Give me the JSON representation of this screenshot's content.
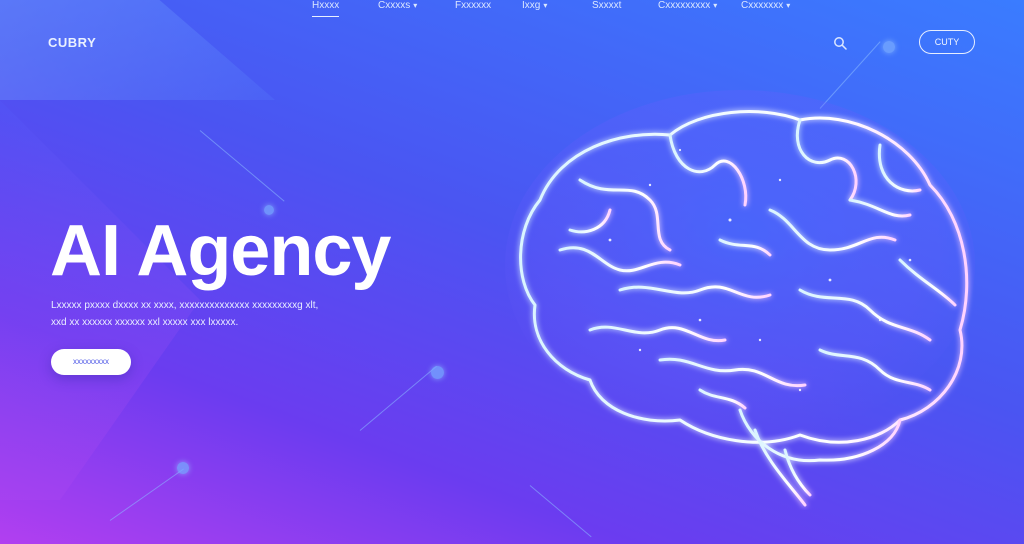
{
  "header": {
    "logo": "CUBRY",
    "nav": [
      {
        "label": "Hxxxx",
        "active": true,
        "dropdown": false
      },
      {
        "label": "Cxxxxs",
        "active": false,
        "dropdown": true
      },
      {
        "label": "Fxxxxxx",
        "active": false,
        "dropdown": false
      },
      {
        "label": "Ixxg",
        "active": false,
        "dropdown": true
      },
      {
        "label": "Sxxxxt",
        "active": false,
        "dropdown": false
      },
      {
        "label": "Cxxxxxxxxx",
        "active": false,
        "dropdown": true
      },
      {
        "label": "Cxxxxxxx",
        "active": false,
        "dropdown": true
      }
    ],
    "button_label": "CUTY"
  },
  "hero": {
    "title": "AI Agency",
    "body_line1": "Lxxxxx pxxxx dxxxx xx xxxx, xxxxxxxxxxxxxx xxxxxxxxxg xlt,",
    "body_line2": "xxd xx xxxxxx xxxxxx xxl xxxxx xxx lxxxxx.",
    "cta_label": "xxxxxxxxx"
  },
  "colors": {
    "bg_top": "#3a7cff",
    "bg_bottom": "#b23ff0",
    "accent": "#4a54e6",
    "glow": "#a8d8ff"
  },
  "icons": {
    "search": "search-icon",
    "brain": "brain-illustration"
  }
}
